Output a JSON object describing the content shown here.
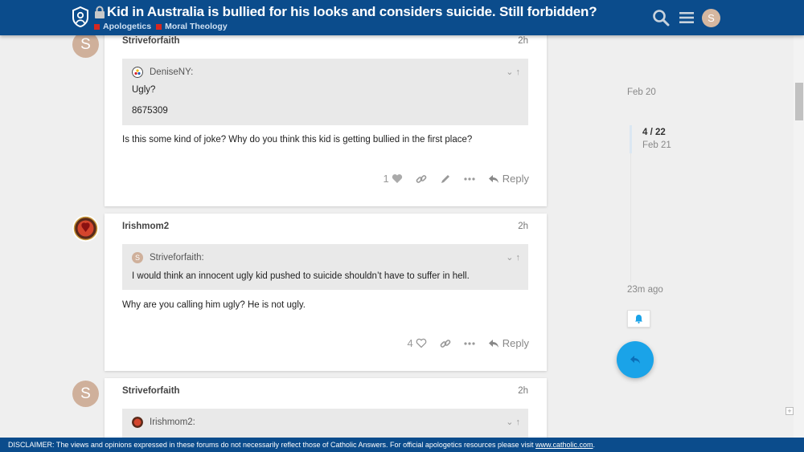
{
  "header": {
    "title": "Kid in Australia is bullied for his looks and considers suicide. Still forbidden?",
    "categories": [
      "Apologetics",
      "Moral Theology"
    ],
    "user_initial": "S"
  },
  "posts": [
    {
      "username": "Striveforfaith",
      "avatar_initial": "S",
      "date": "2h",
      "quote": {
        "author": "DeniseNY:",
        "lines": [
          "Ugly?",
          "8675309"
        ]
      },
      "body": "Is this some kind of joke? Why do you think this kid is getting bullied in the first place?",
      "like_count": "1",
      "reply_label": "Reply"
    },
    {
      "username": "Irishmom2",
      "date": "2h",
      "quote": {
        "author": "Striveforfaith:",
        "author_initial": "S",
        "lines": [
          "I would think an innocent ugly kid pushed to suicide shouldn’t have to suffer in hell."
        ]
      },
      "body": "Why are you calling him ugly? He is not ugly.",
      "like_count": "4",
      "reply_label": "Reply"
    },
    {
      "username": "Striveforfaith",
      "avatar_initial": "S",
      "date": "2h",
      "quote": {
        "author": "Irishmom2:"
      }
    }
  ],
  "timeline": {
    "start_date": "Feb 20",
    "position": "4 / 22",
    "position_date": "Feb 21",
    "end_date": "23m ago"
  },
  "disclaimer": {
    "text": "DISCLAIMER: The views and opinions expressed in these forums do not necessarily reflect those of Catholic Answers. For official apologetics resources please visit ",
    "link": "www.catholic.com",
    "suffix": "."
  },
  "colors": {
    "header_bg": "#0b4c8c",
    "category": "#d6271f",
    "fab": "#1aa3e8",
    "avatar": "#cfb09b"
  },
  "icons": [
    "site-logo-icon",
    "lock-icon",
    "search-icon",
    "hamburger-menu-icon",
    "heart-icon",
    "link-icon",
    "pencil-icon",
    "more-icon",
    "reply-icon",
    "bell-icon",
    "chevron-down-icon",
    "arrow-up-icon"
  ]
}
